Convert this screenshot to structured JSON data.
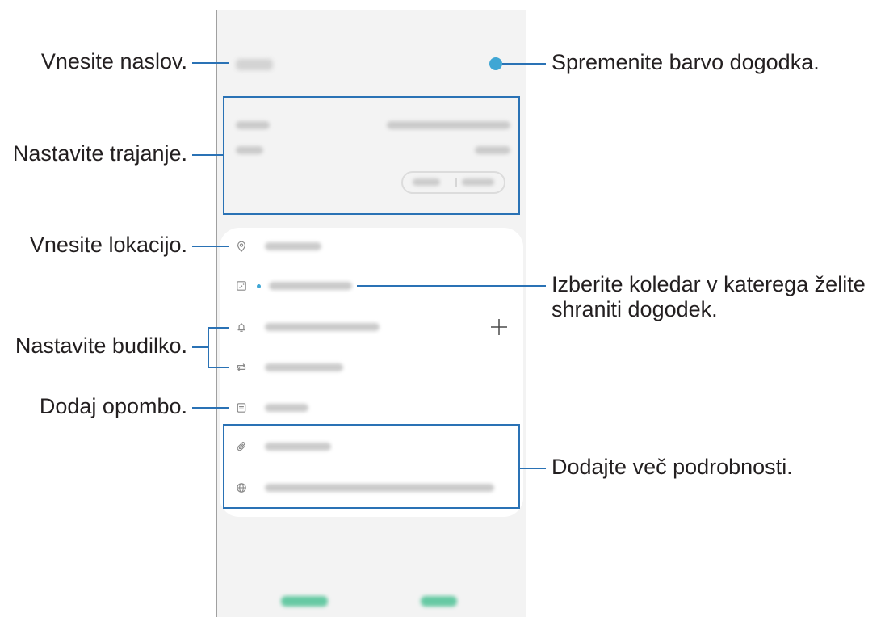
{
  "callouts": {
    "enter_title": "Vnesite naslov.",
    "set_duration": "Nastavite trajanje.",
    "enter_location": "Vnesite lokacijo.",
    "set_alarm": "Nastavite budilko.",
    "add_note": "Dodaj opombo.",
    "change_event_color": "Spremenite barvo dogodka.",
    "choose_calendar": [
      "Izberite koledar v katerega želite",
      "shraniti dogodek."
    ],
    "add_more_details": "Dodajte več podrobnosti."
  },
  "event_form": {
    "row_icons": [
      "location-pin-icon",
      "calendar-icon",
      "bell-icon",
      "repeat-icon",
      "notes-icon",
      "paperclip-icon",
      "globe-icon"
    ],
    "add_alarm_icon": "plus-icon"
  },
  "colors": {
    "callout": "#2a72b5",
    "label_text": "#231f20",
    "event_color": "#3fa6d4",
    "action_text": "#66c9a3",
    "icon": "#8a8a8a",
    "screen_background": "#f3f3f3",
    "card_background": "#ffffff",
    "frame": "#a0a0a0",
    "blurred_text": "#cbcbcb"
  }
}
